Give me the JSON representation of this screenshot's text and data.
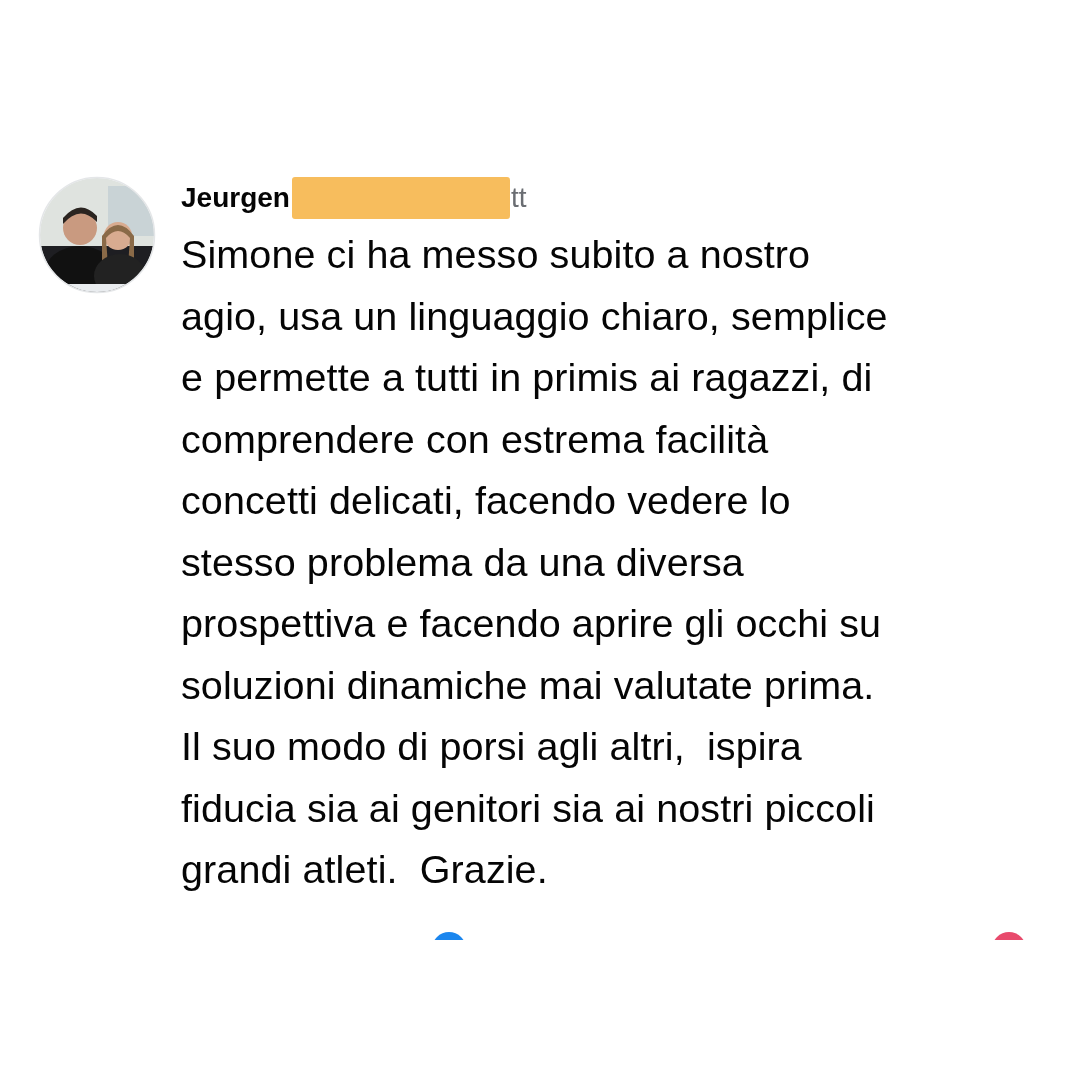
{
  "comment": {
    "author": "Jeurgen",
    "author_tail": "tt",
    "text_lines": [
      "Simone ci ha messo subito a nostro",
      "agio, usa un linguaggio chiaro, semplice",
      "e permette a tutti in primis ai ragazzi, di",
      "comprendere con estrema facilità",
      "concetti delicati, facendo vedere lo",
      "stesso problema da una diversa",
      "prospettiva e facendo aprire gli occhi su",
      "soluzioni dinamiche mai valutate prima.",
      "Il suo modo di porsi agli altri,  ispira",
      "fiducia sia ai genitori sia ai nostri piccoli",
      "grandi atleti.  Grazie."
    ]
  }
}
